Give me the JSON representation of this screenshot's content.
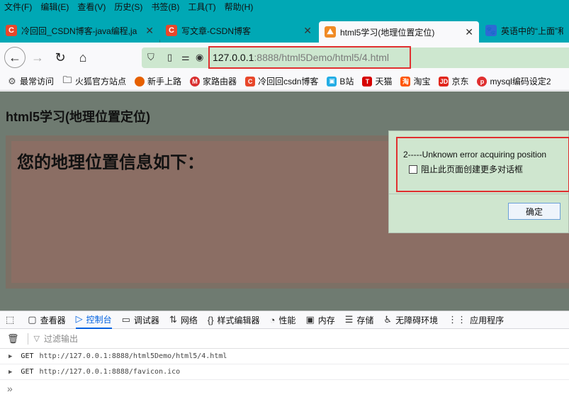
{
  "menu": [
    "文件(F)",
    "编辑(E)",
    "查看(V)",
    "历史(S)",
    "书签(B)",
    "工具(T)",
    "帮助(H)"
  ],
  "tabs": [
    {
      "label": "冷回回_CSDN博客-java编程,ja",
      "icon": "csdn-icon",
      "color": "#e8472b"
    },
    {
      "label": "写文章-CSDN博客",
      "icon": "csdn-icon",
      "color": "#e8472b"
    },
    {
      "label": "html5学习(地理位置定位)",
      "icon": "page-icon",
      "color": "#f08a24"
    },
    {
      "label": "英语中的“上面”和“",
      "icon": "baidu-icon",
      "color": "#2d6ad4"
    }
  ],
  "nav": {
    "url_host": "127.0.0.1",
    "url_rest": ":8888/html5Demo/html5/4.html"
  },
  "bookmarks": [
    {
      "label": "最常访问",
      "icon": "gear-icon",
      "color": "#555555"
    },
    {
      "label": "火狐官方站点",
      "icon": "folder-icon",
      "color": "#666666"
    },
    {
      "label": "新手上路",
      "icon": "firefox-icon",
      "color": "#e66000"
    },
    {
      "label": "家路由器",
      "icon": "router-icon",
      "color": "#d93030"
    },
    {
      "label": "冷回回csdn博客",
      "icon": "csdn-icon",
      "color": "#e8472b"
    },
    {
      "label": "B站",
      "icon": "bilibili-icon",
      "color": "#23ade5"
    },
    {
      "label": "天猫",
      "icon": "tmall-icon",
      "color": "#d60000"
    },
    {
      "label": "淘宝",
      "icon": "taobao-icon",
      "color": "#ff5500"
    },
    {
      "label": "京东",
      "icon": "jd-icon",
      "color": "#e1251b"
    },
    {
      "label": "mysql编码设定2",
      "icon": "php-icon",
      "color": "#e03030"
    }
  ],
  "page": {
    "heading": "html5学习(地理位置定位)",
    "geo_title": "您的地理位置信息如下："
  },
  "dialog": {
    "message": "2-----Unknown error acquiring position",
    "checkbox_label": "阻止此页面创建更多对话框",
    "ok_label": "确定"
  },
  "devtools": {
    "tabs": [
      {
        "label": "查看器",
        "icon": "inspector-icon",
        "glyph": "▢"
      },
      {
        "label": "控制台",
        "icon": "console-icon",
        "glyph": "▷",
        "active": true
      },
      {
        "label": "调试器",
        "icon": "debugger-icon",
        "glyph": "▭"
      },
      {
        "label": "网络",
        "icon": "network-icon",
        "glyph": "⇅"
      },
      {
        "label": "样式编辑器",
        "icon": "style-editor-icon",
        "glyph": "{}"
      },
      {
        "label": "性能",
        "icon": "performance-icon",
        "glyph": "◔"
      },
      {
        "label": "内存",
        "icon": "memory-icon",
        "glyph": "▣"
      },
      {
        "label": "存储",
        "icon": "storage-icon",
        "glyph": "☰"
      },
      {
        "label": "无障碍环境",
        "icon": "accessibility-icon",
        "glyph": "♿"
      },
      {
        "label": "应用程序",
        "icon": "application-icon",
        "glyph": "⋮⋮"
      }
    ],
    "filter_placeholder": "过滤输出",
    "logs": [
      {
        "method": "GET",
        "url": "http://127.0.0.1:8888/html5Demo/html5/4.html"
      },
      {
        "method": "GET",
        "url": "http://127.0.0.1:8888/favicon.ico"
      }
    ],
    "prompt": "»"
  }
}
